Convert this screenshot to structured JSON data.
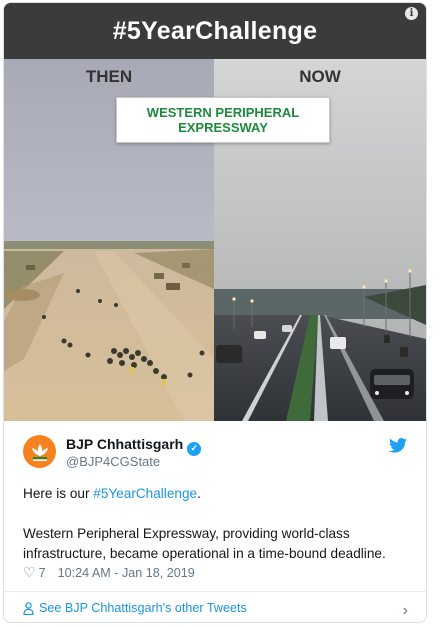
{
  "media": {
    "banner": "#5YearChallenge",
    "then_label": "THEN",
    "now_label": "NOW",
    "sign_line1": "WESTERN PERIPHERAL",
    "sign_line2": "EXPRESSWAY",
    "info_glyph": "i"
  },
  "tweet": {
    "author_name": "BJP Chhattisgarh",
    "author_handle": "@BJP4CGState",
    "verified_glyph": "✓",
    "text_intro": "Here is our ",
    "text_hashtag": "#5YearChallenge",
    "text_period": ".",
    "text_body": "Western Peripheral Expressway, providing world-class infrastructure, became operational in a time-bound deadline.",
    "likes": "7",
    "timestamp": "10:24 AM - Jan 18, 2019",
    "see_more": "See BJP Chhattisgarh's other Tweets"
  },
  "icons": {
    "avatar": "bjp-lotus-logo",
    "twitter": "twitter-bird-icon",
    "heart": "heart-icon",
    "person": "person-icon",
    "chevron": "chevron-right-icon"
  },
  "colors": {
    "banner_bg": "#3b3b3b",
    "sign_text": "#1e8a3c",
    "link": "#1b95e0",
    "verified": "#1da1f2",
    "avatar_bg": "#f5821f",
    "muted_text": "#657786"
  }
}
